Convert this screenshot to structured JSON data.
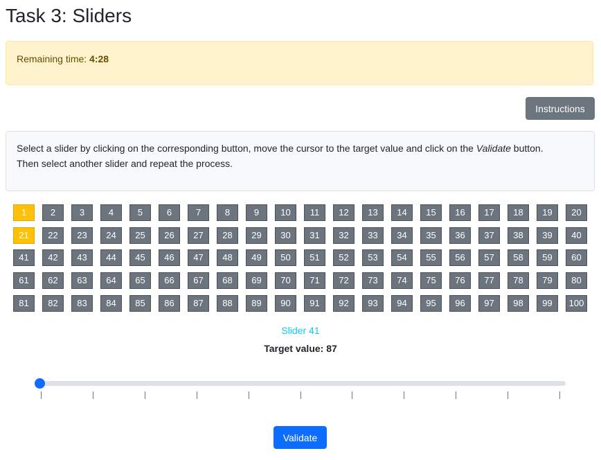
{
  "page": {
    "title": "Task 3: Sliders"
  },
  "timer": {
    "label": "Remaining time:",
    "value": "4:28"
  },
  "instructions_button": {
    "label": "Instructions"
  },
  "info": {
    "text_before": "Select a slider by clicking on the corresponding button, move the cursor to the target value and click on the ",
    "emphasis": "Validate",
    "text_after": " button.",
    "line2": "Then select another slider and repeat the process."
  },
  "slider_buttons": {
    "labels": [
      "1",
      "2",
      "3",
      "4",
      "5",
      "6",
      "7",
      "8",
      "9",
      "10",
      "11",
      "12",
      "13",
      "14",
      "15",
      "16",
      "17",
      "18",
      "19",
      "20",
      "21",
      "22",
      "23",
      "24",
      "25",
      "26",
      "27",
      "28",
      "29",
      "30",
      "31",
      "32",
      "33",
      "34",
      "35",
      "36",
      "37",
      "38",
      "39",
      "40",
      "41",
      "42",
      "43",
      "44",
      "45",
      "46",
      "47",
      "48",
      "49",
      "50",
      "51",
      "52",
      "53",
      "54",
      "55",
      "56",
      "57",
      "58",
      "59",
      "60",
      "61",
      "62",
      "63",
      "64",
      "65",
      "66",
      "67",
      "68",
      "69",
      "70",
      "71",
      "72",
      "73",
      "74",
      "75",
      "76",
      "77",
      "78",
      "79",
      "80",
      "81",
      "82",
      "83",
      "84",
      "85",
      "86",
      "87",
      "88",
      "89",
      "90",
      "91",
      "92",
      "93",
      "94",
      "95",
      "96",
      "97",
      "98",
      "99",
      "100"
    ],
    "completed": [
      "1",
      "21"
    ],
    "colors": {
      "default": "#6c757d",
      "completed": "#ffc107"
    }
  },
  "current_slider": {
    "name": "Slider 41",
    "target_label": "Target value: 87",
    "value_fraction": 0.0
  },
  "validate_button": {
    "label": "Validate"
  },
  "colors": {
    "primary": "#0d6efd",
    "info": "#0dcaf0",
    "warning_bg": "#fff3cd",
    "secondary": "#6c757d"
  }
}
